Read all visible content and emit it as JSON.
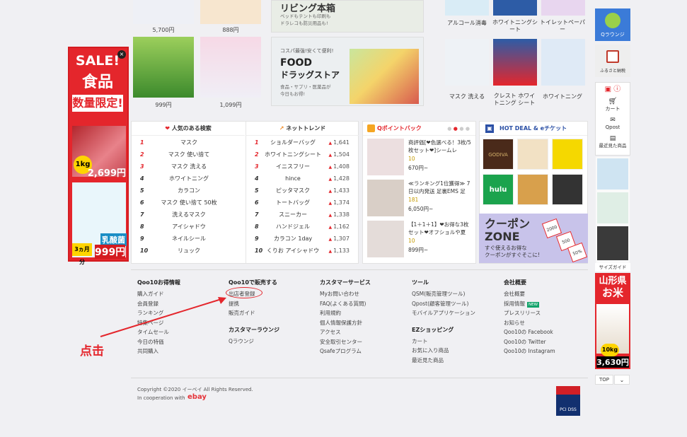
{
  "top_products": [
    {
      "label": "5,700円"
    },
    {
      "label": "888円"
    }
  ],
  "top_banner": {
    "text": "リビング本箱",
    "sub": "ベッドもテントも印刷も\nドラレコも防災用品も!"
  },
  "top_right_items": [
    {
      "label": "アルコール消毒"
    },
    {
      "label": "ホワイトニングシート"
    },
    {
      "label": "トイレットペーパー"
    }
  ],
  "products_row2": [
    {
      "label": "999円"
    },
    {
      "label": "1,099円"
    }
  ],
  "food_banner": {
    "tag": "コスパ最強!安くて便利!",
    "title1": "FOOD",
    "title2": "ドラッグストア",
    "sub": "食品・サプリ・医薬品が\n今日もお得!"
  },
  "right_items_row2": [
    {
      "label": "マスク 洗える"
    },
    {
      "label": "クレスト ホワイトニング シート"
    },
    {
      "label": "ホワイトニング"
    }
  ],
  "sale_banner": {
    "sale": "SALE!",
    "food": "食品",
    "limited": "数量限定!",
    "weight": "1kg",
    "price1": "2,699円",
    "product_label": "乳酸菌",
    "months": "3ヵ月分",
    "price2": "999円",
    "close": "×"
  },
  "ranking": {
    "popular_title": "人気のある検索",
    "trend_title": "ネットトレンド",
    "popular": [
      {
        "rank": "1",
        "keyword": "マスク"
      },
      {
        "rank": "2",
        "keyword": "マスク 使い捨て"
      },
      {
        "rank": "3",
        "keyword": "マスク 洗える"
      },
      {
        "rank": "4",
        "keyword": "ホワイトニング"
      },
      {
        "rank": "5",
        "keyword": "カラコン"
      },
      {
        "rank": "6",
        "keyword": "マスク 使い捨て 50枚"
      },
      {
        "rank": "7",
        "keyword": "洗えるマスク"
      },
      {
        "rank": "8",
        "keyword": "アイシャドウ"
      },
      {
        "rank": "9",
        "keyword": "ネイルシール"
      },
      {
        "rank": "10",
        "keyword": "リュック"
      }
    ],
    "trend": [
      {
        "rank": "1",
        "keyword": "ショルダーバッグ",
        "count": "1,641"
      },
      {
        "rank": "2",
        "keyword": "ホワイトニングシート",
        "count": "1,504"
      },
      {
        "rank": "3",
        "keyword": "イニスフリー",
        "count": "1,408"
      },
      {
        "rank": "4",
        "keyword": "hince",
        "count": "1,428"
      },
      {
        "rank": "5",
        "keyword": "ピッタマスク",
        "count": "1,433"
      },
      {
        "rank": "6",
        "keyword": "トートバッグ",
        "count": "1,374"
      },
      {
        "rank": "7",
        "keyword": "スニーカー",
        "count": "1,338"
      },
      {
        "rank": "8",
        "keyword": "ハンドジェル",
        "count": "1,162"
      },
      {
        "rank": "9",
        "keyword": "カラコン 1day",
        "count": "1,307"
      },
      {
        "rank": "10",
        "keyword": "くりお アイシャドウ",
        "count": "1,133"
      }
    ]
  },
  "qpoint": {
    "title": "Qポイントバック",
    "items": [
      {
        "text": "商評価[❤色選べる！3枚/5枚セット❤]シームレ",
        "points": "10",
        "price": "670円~"
      },
      {
        "text": "≪ランキング1位獲得≫ 7日以内発送 足裏EMS 足",
        "points": "181",
        "price": "6,050円~"
      },
      {
        "text": "【1＋1＋1】❤お得な3枚セット❤オフショルや夏",
        "points": "10",
        "price": "899円~"
      }
    ]
  },
  "hotdeal": {
    "title": "HOT DEAL & eチケット",
    "tiles": [
      "GODIVA",
      "",
      "",
      "hulu",
      "",
      "",
      "",
      "",
      ""
    ],
    "coupon_title1": "クーポン",
    "coupon_title2": "ZONE",
    "coupon_sub": "すぐ使えるお得な\nクーポンがすぐそこに!",
    "coupon_values": [
      "2000",
      "500",
      "50%"
    ]
  },
  "footer": {
    "cols": [
      {
        "title": "Qoo10お得情報",
        "links": [
          "購入ガイド",
          "会員登録",
          "ランキング",
          "特集ページ",
          "タイムセール",
          "今日の特価",
          "共同購入"
        ]
      },
      {
        "title": "Qoo10で販売する",
        "links": [
          "出店者登録",
          "提携",
          "販売ガイド"
        ],
        "title2": "カスタマーラウンジ",
        "links2": [
          "Qラウンジ"
        ]
      },
      {
        "title": "カスタマーサービス",
        "links": [
          "Myお問い合わせ",
          "FAQ(よくある質問)",
          "利用規約",
          "個人情報保護方針",
          "アクセス",
          "安全取引センター",
          "Qsafeプログラム"
        ]
      },
      {
        "title": "ツール",
        "links": [
          "QSM(販売管理ツール)",
          "Qpost(顧客管理ツール)",
          "モバイルアプリケーション"
        ],
        "title2": "EZショッピング",
        "links2": [
          "カート",
          "お気に入り商品",
          "最近見た商品"
        ]
      },
      {
        "title": "会社概要",
        "links": [
          "会社概要",
          "採用情報",
          "プレスリリース",
          "お知らせ",
          "Qoo10の Facebook",
          "Qoo10の Twitter",
          "Qoo10の Instagram"
        ],
        "new": "NEW"
      }
    ],
    "copyright": "Copyright ©2020 イーベイ All Rights Reserved.",
    "coop": "In cooperation with",
    "ebay": "ebay",
    "pci": "PCI DSS"
  },
  "annotation": {
    "click": "点击"
  },
  "sidebar": {
    "qlounge": "Qラウンジ",
    "furusato": "ふるさと納税",
    "cart": "カート",
    "qpost": "Qpost",
    "recent": "最近見た商品",
    "size_guide": "サイズガイド",
    "yamagata1": "山形県",
    "yamagata2": "お米",
    "yama_weight": "10kg",
    "yama_price": "3,630円",
    "top": "TOP",
    "down": "⌄"
  },
  "colors": {
    "brand_red": "#e4262c",
    "qpoint_red": "#e4262c",
    "hotdeal_blue": "#2a4fa5"
  }
}
